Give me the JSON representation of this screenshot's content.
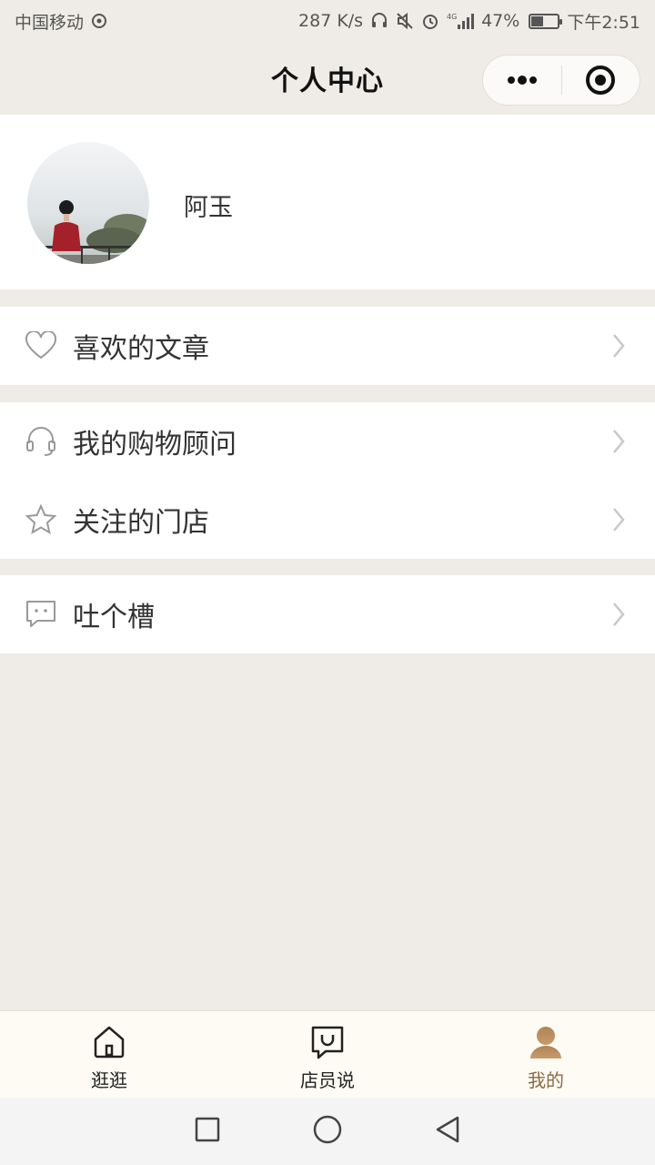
{
  "status_bar": {
    "carrier": "中国移动",
    "speed": "287 K/s",
    "battery_percent": "47%",
    "battery_level": 0.47,
    "time": "下午2:51",
    "icons": [
      "signal-icon",
      "headphone-icon",
      "mute-icon",
      "alarm-icon",
      "4g-signal-icon",
      "battery-icon"
    ]
  },
  "nav": {
    "title": "个人中心",
    "capsule": [
      "more-dots-icon",
      "close-target-icon"
    ]
  },
  "profile": {
    "nickname": "阿玉",
    "avatar": "user-avatar-photo"
  },
  "menu": {
    "groups": [
      [
        {
          "label": "喜欢的文章",
          "icon": "heart-icon"
        }
      ],
      [
        {
          "label": "我的购物顾问",
          "icon": "headset-icon"
        },
        {
          "label": "关注的门店",
          "icon": "star-icon"
        }
      ],
      [
        {
          "label": "吐个槽",
          "icon": "chat-bubble-icon"
        }
      ]
    ]
  },
  "tabbar": {
    "tabs": [
      {
        "label": "逛逛",
        "icon": "home-icon"
      },
      {
        "label": "店员说",
        "icon": "message-smile-icon"
      },
      {
        "label": "我的",
        "icon": "person-icon",
        "active": true
      }
    ],
    "active_color": "#8c6a45"
  },
  "system_nav": [
    "square-recent-icon",
    "circle-home-icon",
    "triangle-back-icon"
  ]
}
